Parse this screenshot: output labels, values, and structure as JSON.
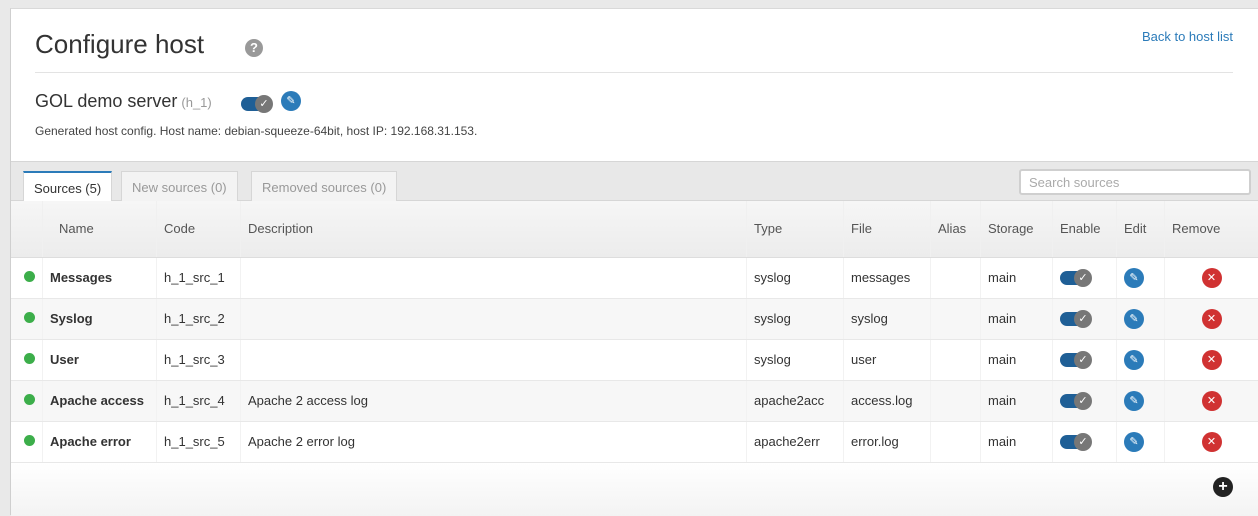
{
  "header": {
    "title": "Configure host",
    "help_icon": "?",
    "back_link": "Back to host list"
  },
  "host": {
    "name": "GOL demo server",
    "code": "(h_1)",
    "enabled": true,
    "description": "Generated host config. Host name: debian-squeeze-64bit, host IP: 192.168.31.153."
  },
  "tabs": [
    {
      "label": "Sources (5)",
      "active": true
    },
    {
      "label": "New sources (0)",
      "active": false
    },
    {
      "label": "Removed sources (0)",
      "active": false
    }
  ],
  "search": {
    "placeholder": "Search sources",
    "value": ""
  },
  "columns": {
    "name": "Name",
    "code": "Code",
    "description": "Description",
    "type": "Type",
    "file": "File",
    "alias": "Alias",
    "storage": "Storage",
    "enable": "Enable",
    "edit": "Edit",
    "remove": "Remove"
  },
  "rows": [
    {
      "name": "Messages",
      "code": "h_1_src_1",
      "description": "",
      "type": "syslog",
      "file": "messages",
      "alias": "",
      "storage": "main",
      "enabled": true
    },
    {
      "name": "Syslog",
      "code": "h_1_src_2",
      "description": "",
      "type": "syslog",
      "file": "syslog",
      "alias": "",
      "storage": "main",
      "enabled": true
    },
    {
      "name": "User",
      "code": "h_1_src_3",
      "description": "",
      "type": "syslog",
      "file": "user",
      "alias": "",
      "storage": "main",
      "enabled": true
    },
    {
      "name": "Apache access",
      "code": "h_1_src_4",
      "description": "Apache 2 access log",
      "type": "apache2acc",
      "file": "access.log",
      "alias": "",
      "storage": "main",
      "enabled": true
    },
    {
      "name": "Apache error",
      "code": "h_1_src_5",
      "description": "Apache 2 error log",
      "type": "apache2err",
      "file": "error.log",
      "alias": "",
      "storage": "main",
      "enabled": true
    }
  ],
  "icons": {
    "status": "status-dot-icon",
    "toggle": "toggle-check-icon",
    "edit": "pencil-icon",
    "remove": "close-icon",
    "add": "plus-icon"
  },
  "colors": {
    "accent": "#2b7bb9",
    "status_active": "#3cae4a",
    "remove": "#d03232",
    "toggle_on": "#1f5f96"
  }
}
